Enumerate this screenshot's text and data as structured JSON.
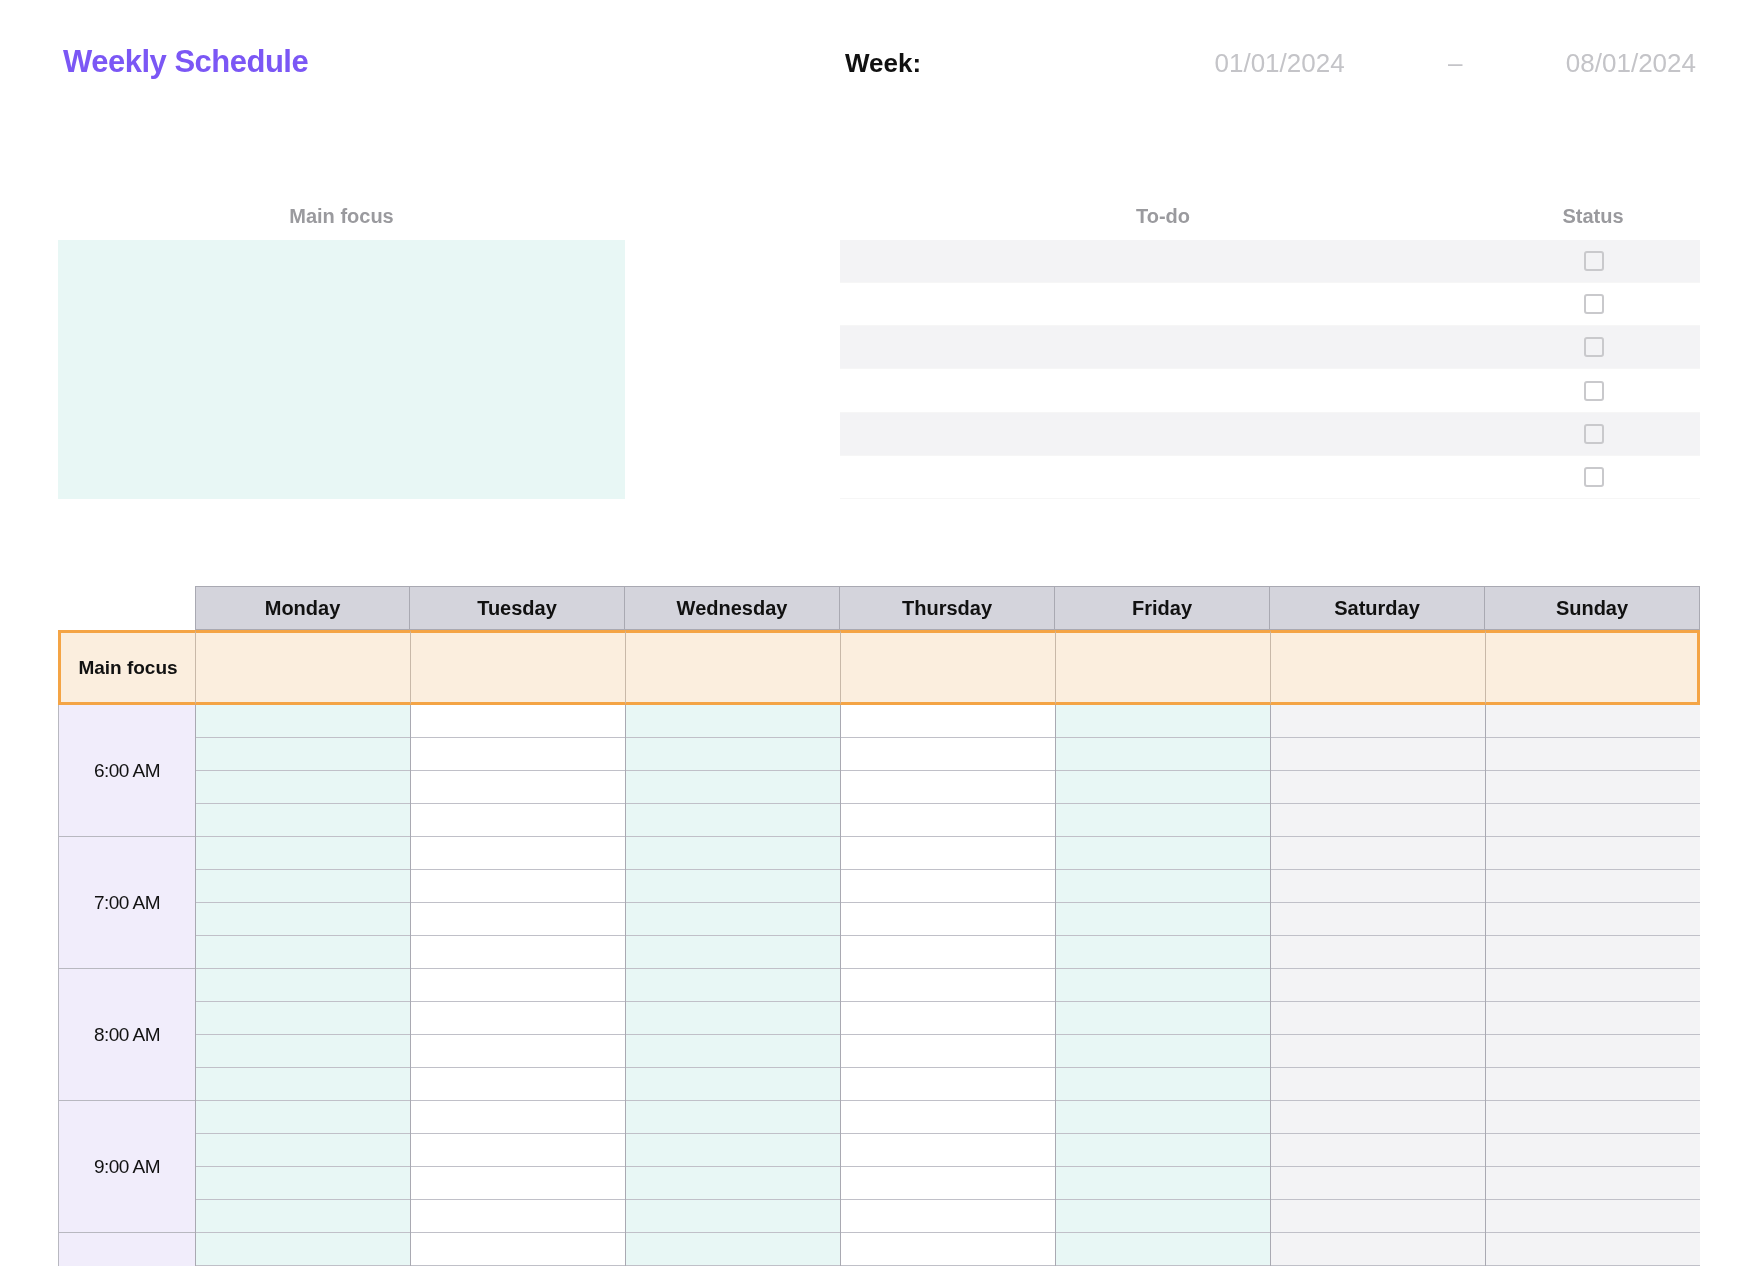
{
  "title": "Weekly Schedule",
  "week": {
    "label": "Week:",
    "start": "01/01/2024",
    "separator": "–",
    "end": "08/01/2024"
  },
  "main_focus": {
    "label": "Main focus"
  },
  "todo": {
    "columns": [
      "To-do",
      "Status"
    ],
    "rows": [
      {
        "checked": false
      },
      {
        "checked": false
      },
      {
        "checked": false
      },
      {
        "checked": false
      },
      {
        "checked": false
      },
      {
        "checked": false
      }
    ]
  },
  "schedule": {
    "days": [
      {
        "label": "Monday",
        "kind": "teal"
      },
      {
        "label": "Tuesday",
        "kind": "white"
      },
      {
        "label": "Wednesday",
        "kind": "teal"
      },
      {
        "label": "Thursday",
        "kind": "white"
      },
      {
        "label": "Friday",
        "kind": "teal"
      },
      {
        "label": "Saturday",
        "kind": "gray"
      },
      {
        "label": "Sunday",
        "kind": "gray"
      }
    ],
    "focus_row": "Main focus",
    "hours": [
      "6:00 AM",
      "7:00 AM",
      "8:00 AM",
      "9:00 AM"
    ]
  }
}
